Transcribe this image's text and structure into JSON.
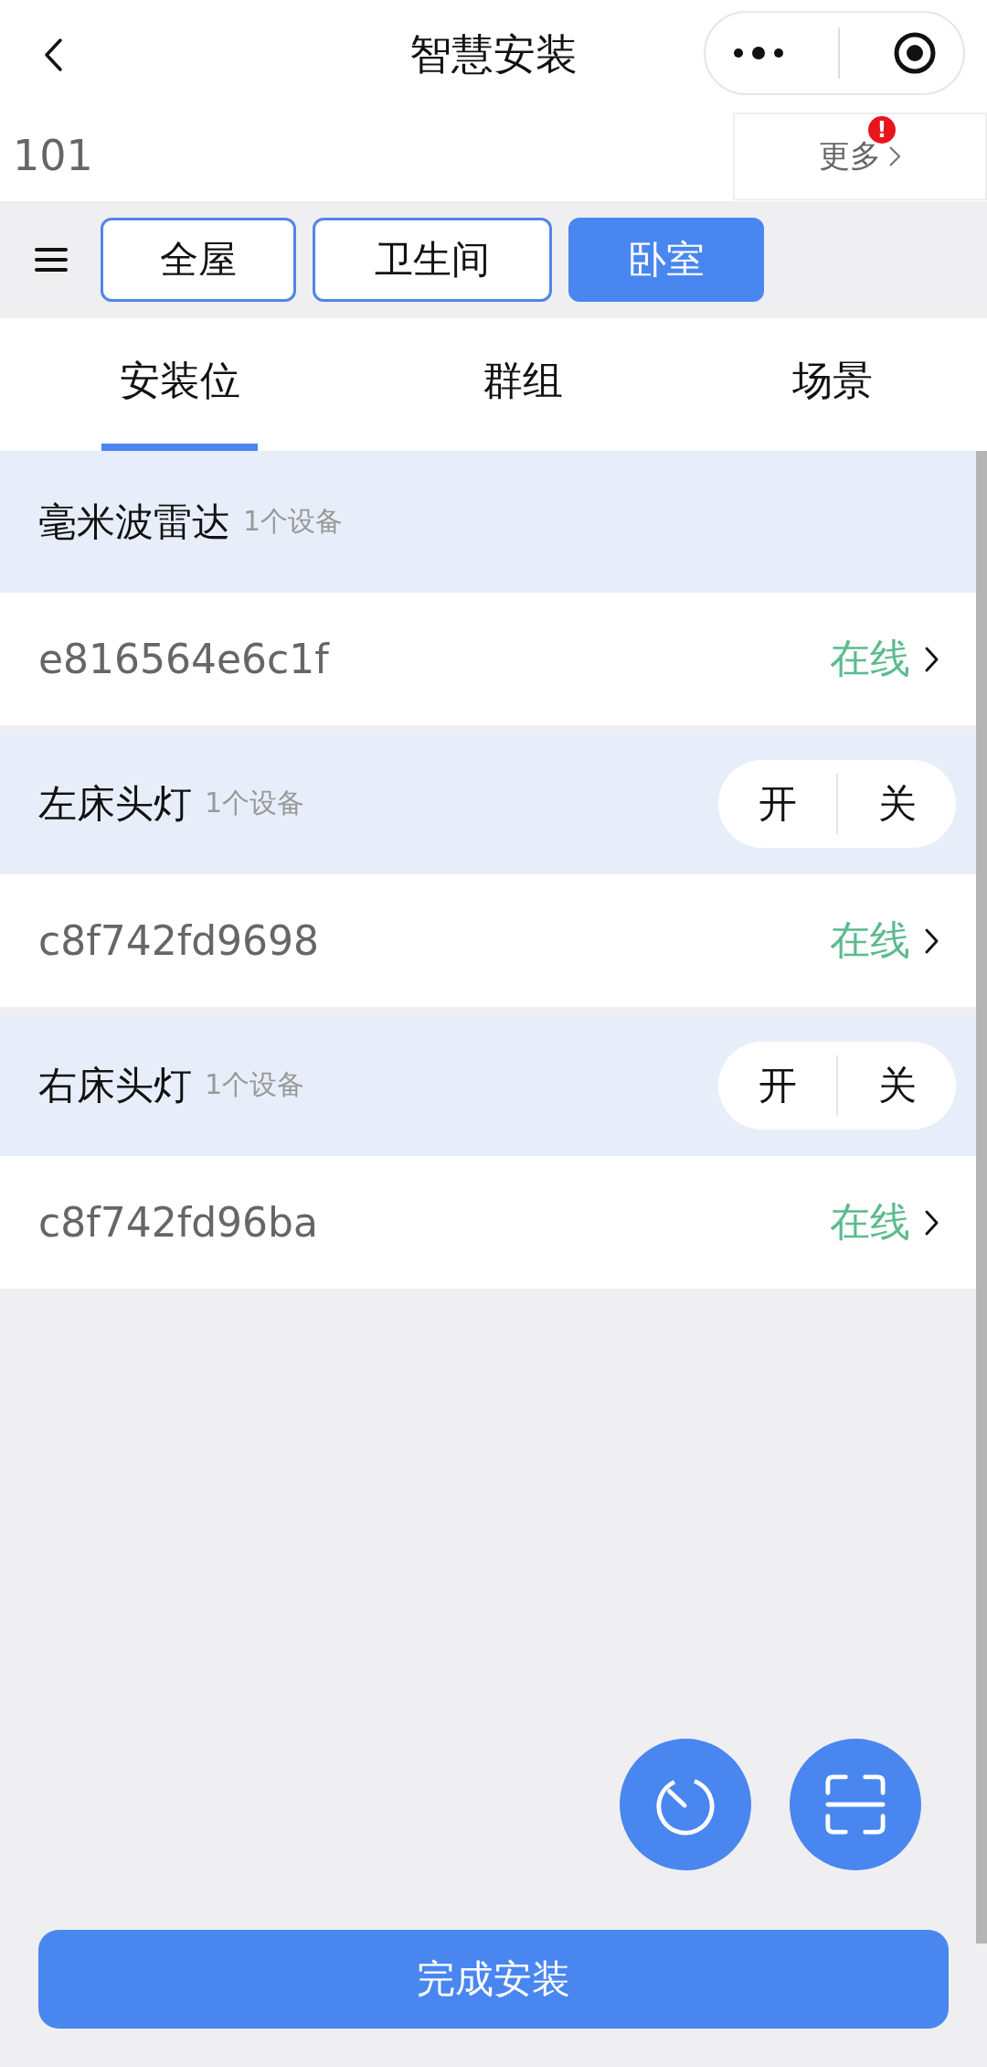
{
  "window": {
    "title": "智慧安装"
  },
  "room_bar": {
    "name": "101",
    "more": {
      "label": "更多",
      "badge": "!"
    }
  },
  "rooms": [
    {
      "label": "全屋",
      "selected": false
    },
    {
      "label": "卫生间",
      "selected": false
    },
    {
      "label": "卧室",
      "selected": true
    }
  ],
  "tabs": [
    {
      "label": "安装位",
      "selected": true
    },
    {
      "label": "群组",
      "selected": false
    },
    {
      "label": "场景",
      "selected": false
    }
  ],
  "groups": [
    {
      "name": "毫米波雷达",
      "count": "1个设备",
      "devices": [
        {
          "id": "e816564e6c1f",
          "status": "在线"
        }
      ]
    },
    {
      "name": "左床头灯",
      "count": "1个设备",
      "controls": [
        "开",
        "关"
      ],
      "devices": [
        {
          "id": "c8f742fd9698",
          "status": "在线"
        }
      ]
    },
    {
      "name": "右床头灯",
      "count": "1个设备",
      "controls": [
        "开",
        "关"
      ],
      "devices": [
        {
          "id": "c8f742fd96ba",
          "status": "在线"
        }
      ]
    }
  ],
  "primary_button": "完成安装"
}
